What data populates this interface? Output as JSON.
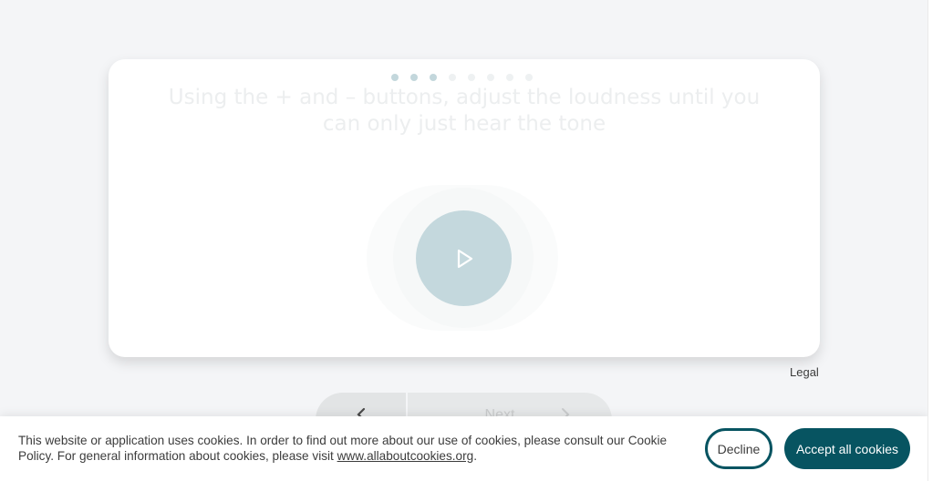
{
  "test": {
    "steps_total": 8,
    "steps_active": 3,
    "instruction": "Using the + and – buttons, adjust the loudness until you can only just hear the tone",
    "play_icon": "play-icon"
  },
  "footer": {
    "legal_label": "Legal"
  },
  "nav": {
    "back_icon": "chevron-left-icon",
    "next_label": "Next",
    "next_icon": "chevron-right-icon"
  },
  "cookie_banner": {
    "text_before_link": "This website or application uses cookies. In order to find out more about our use of cookies, please consult our Cookie Policy. For general information about cookies, please visit ",
    "link_text": "www.allaboutcookies.org",
    "text_after_link": ".",
    "decline_label": "Decline",
    "accept_label": "Accept all cookies"
  },
  "colors": {
    "brand": "#075461",
    "play_button": "#c4d8dd",
    "background": "#f4f5f7"
  }
}
